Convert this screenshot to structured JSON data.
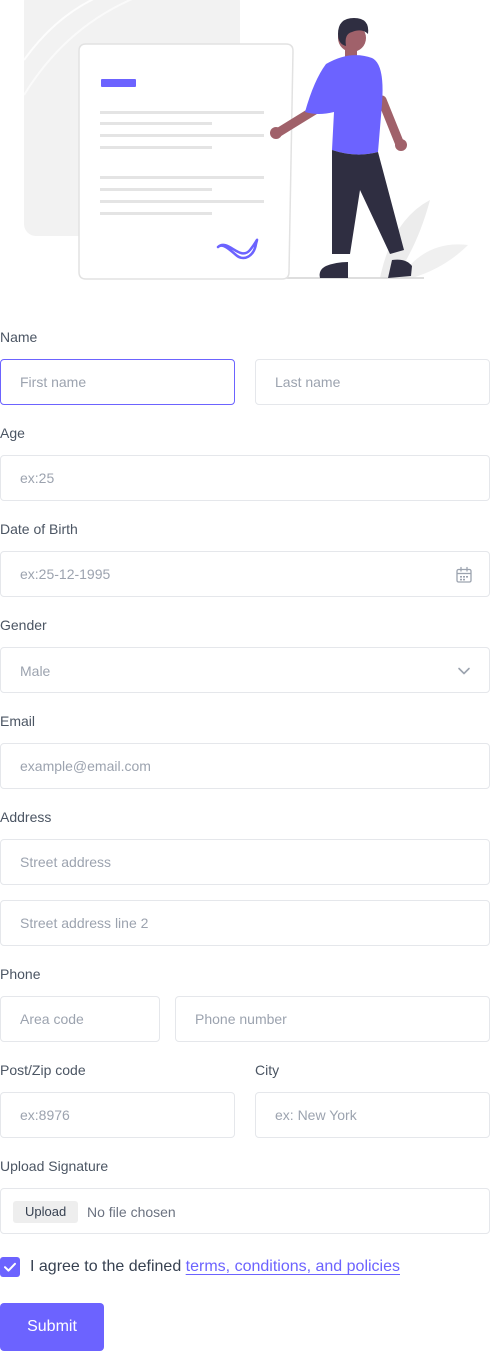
{
  "colors": {
    "accent": "#6c63ff",
    "border": "#e5e7eb",
    "label": "#4b5563",
    "placeholder": "#9ca3af"
  },
  "hero": {
    "illustration": "person-with-signed-document-illustration"
  },
  "form": {
    "name": {
      "label": "Name",
      "first_placeholder": "First name",
      "last_placeholder": "Last name"
    },
    "age": {
      "label": "Age",
      "placeholder": "ex:25"
    },
    "dob": {
      "label": "Date of Birth",
      "placeholder": "ex:25-12-1995",
      "icon": "calendar-icon"
    },
    "gender": {
      "label": "Gender",
      "selected": "Male",
      "icon": "chevron-down-icon"
    },
    "email": {
      "label": "Email",
      "placeholder": "example@email.com"
    },
    "address": {
      "label": "Address",
      "line1_placeholder": "Street address",
      "line2_placeholder": "Street address line 2"
    },
    "phone": {
      "label": "Phone",
      "area_placeholder": "Area code",
      "number_placeholder": "Phone number"
    },
    "zip": {
      "label": "Post/Zip code",
      "placeholder": "ex:8976"
    },
    "city": {
      "label": "City",
      "placeholder": "ex: New York"
    },
    "signature": {
      "label": "Upload Signature",
      "button": "Upload",
      "status": "No file chosen"
    },
    "agree": {
      "checked": true,
      "text": "I agree to the defined ",
      "link": "terms, conditions, and policies"
    },
    "submit": "Submit"
  }
}
